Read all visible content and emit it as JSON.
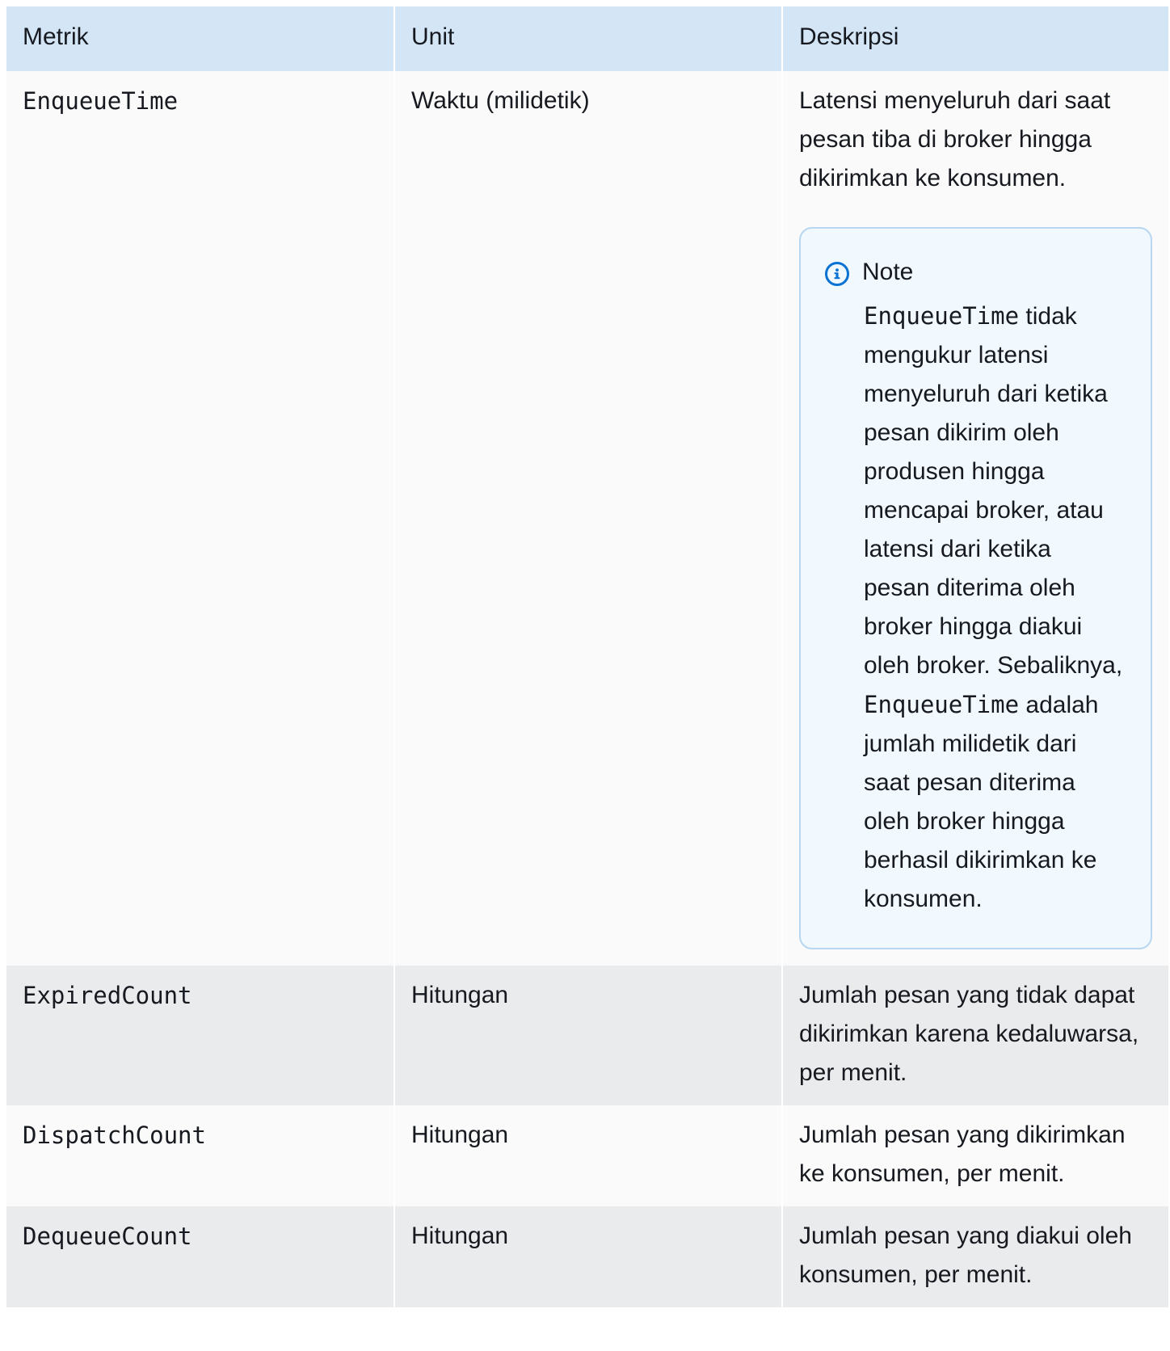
{
  "headers": {
    "metric": "Metrik",
    "unit": "Unit",
    "description": "Deskripsi"
  },
  "rows": [
    {
      "metric": "EnqueueTime",
      "unit": "Waktu (milidetik)",
      "description": "Latensi menyeluruh dari saat pesan tiba di broker hingga dikirimkan ke konsumen.",
      "note": {
        "title": "Note",
        "code1": "EnqueueTime",
        "text1": " tidak mengukur latensi menyeluruh dari ketika pesan dikirim oleh produsen hingga mencapai broker, atau latensi dari ketika pesan diterima oleh broker hingga diakui oleh broker. Sebaliknya, ",
        "code2": "EnqueueTime",
        "text2": " adalah jumlah milidetik dari saat pesan diterima oleh broker hingga berhasil dikirimkan ke konsumen."
      }
    },
    {
      "metric": "ExpiredCount",
      "unit": "Hitungan",
      "description": "Jumlah pesan yang tidak dapat dikirimkan karena kedaluwarsa, per menit."
    },
    {
      "metric": "DispatchCount",
      "unit": "Hitungan",
      "description": "Jumlah pesan yang dikirimkan ke konsumen, per menit."
    },
    {
      "metric": "DequeueCount",
      "unit": "Hitungan",
      "description": "Jumlah pesan yang diakui oleh konsumen, per menit."
    }
  ],
  "colors": {
    "header_bg": "#d4e5f6",
    "row_light": "#fafafa",
    "row_dark": "#eaebec",
    "note_border": "#b8d6f2",
    "note_bg": "#f1f8fe",
    "info_blue": "#0972d3"
  },
  "icons": {
    "note": "info-icon"
  }
}
